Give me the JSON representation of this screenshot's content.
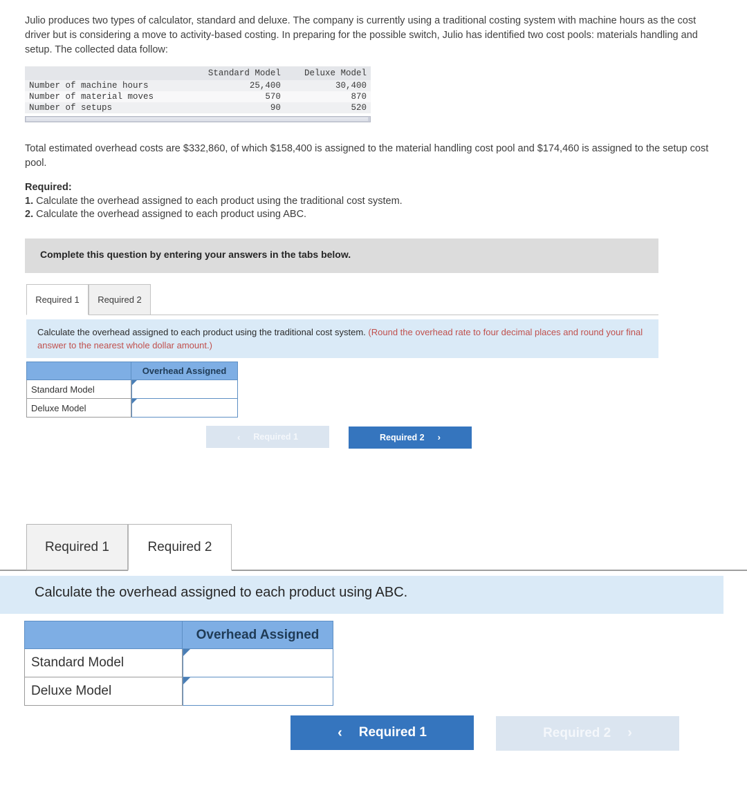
{
  "problem": {
    "paragraph1": "Julio produces two types of calculator, standard and deluxe. The company is currently using a traditional costing system with machine hours as the cost driver but is considering a move to activity-based costing. In preparing for the possible switch, Julio has identified two cost pools: materials handling and setup. The collected data follow:",
    "paragraph2": "Total estimated overhead costs are $332,860, of which $158,400 is assigned to the material handling cost pool and $174,460 is assigned to the setup cost pool.",
    "required_heading": "Required:",
    "required_items": [
      {
        "number": "1.",
        "text": " Calculate the overhead assigned to each product using the traditional cost system."
      },
      {
        "number": "2.",
        "text": " Calculate the overhead assigned to each product using ABC."
      }
    ]
  },
  "data_table": {
    "columns": [
      "",
      "Standard Model",
      "Deluxe Model"
    ],
    "rows": [
      {
        "label": "Number of machine hours",
        "standard": "25,400",
        "deluxe": "30,400"
      },
      {
        "label": "Number of material moves",
        "standard": "570",
        "deluxe": "870"
      },
      {
        "label": "Number of setups",
        "standard": "90",
        "deluxe": "520"
      }
    ]
  },
  "gray_banner": {
    "text": "Complete this question by entering your answers in the tabs below."
  },
  "section1": {
    "tabs": [
      {
        "label": "Required 1",
        "active": true
      },
      {
        "label": "Required 2",
        "active": false
      }
    ],
    "instruction_main": "Calculate the overhead assigned to each product using the traditional cost system. ",
    "instruction_note": "(Round the overhead rate to four decimal places and round your final answer to the nearest whole dollar amount.)",
    "answer_table": {
      "header_blank": "",
      "header_label": "Overhead Assigned",
      "rows": [
        {
          "label": "Standard Model",
          "value": ""
        },
        {
          "label": "Deluxe Model",
          "value": ""
        }
      ]
    },
    "nav": {
      "prev_label": "Required 1",
      "prev_chevron": "‹",
      "prev_state": "disabled",
      "next_label": "Required 2",
      "next_chevron": "›",
      "next_state": "primary"
    }
  },
  "section2": {
    "tabs": [
      {
        "label": "Required 1",
        "active": false
      },
      {
        "label": "Required 2",
        "active": true
      }
    ],
    "instruction_main": "Calculate the overhead assigned to each product using ABC.",
    "answer_table": {
      "header_blank": "",
      "header_label": "Overhead Assigned",
      "rows": [
        {
          "label": "Standard Model",
          "value": ""
        },
        {
          "label": "Deluxe Model",
          "value": ""
        }
      ]
    },
    "nav": {
      "prev_label": "Required 1",
      "prev_chevron": "‹",
      "prev_state": "primary",
      "next_label": "Required 2",
      "next_chevron": "›",
      "next_state": "disabled"
    }
  },
  "colors": {
    "accent_blue": "#3575be",
    "table_header_blue": "#7eaee4",
    "banner_light_blue": "#daeaf7",
    "banner_gray": "#dcdcdc",
    "note_red": "#c0504d"
  }
}
